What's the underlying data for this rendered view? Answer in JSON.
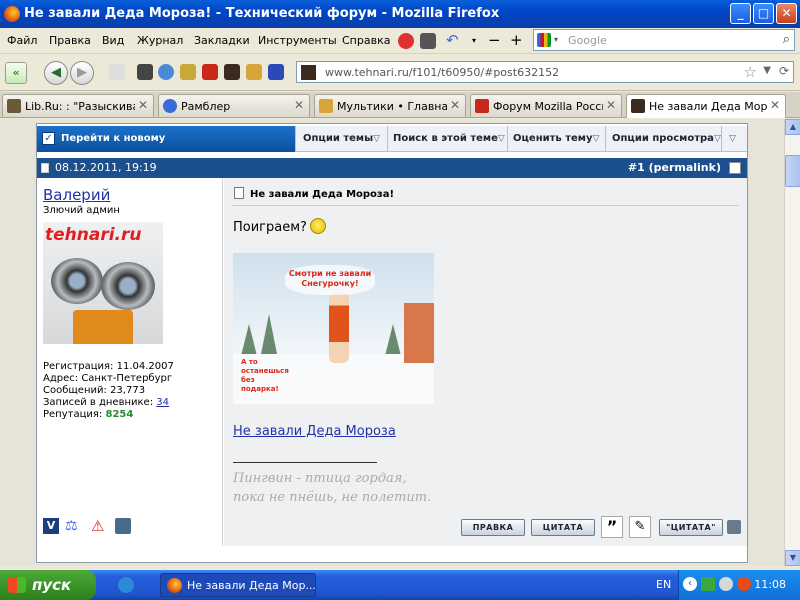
{
  "window": {
    "title": "Не завали Деда Мороза! - Технический форум - Mozilla Firefox",
    "min": "_",
    "max": "□",
    "close": "✕"
  },
  "menu": {
    "items": [
      "Файл",
      "Правка",
      "Вид",
      "Журнал",
      "Закладки",
      "Инструменты",
      "Справка"
    ],
    "search_placeholder": "Google"
  },
  "nav": {
    "back": "◀",
    "forward": "▶",
    "url": "www.tehnari.ru/f101/t60950/#post632152"
  },
  "tabs": [
    {
      "label": "Lib.Ru: : \"Разыскива...",
      "icon_color": "#6a5a3a"
    },
    {
      "label": "Рамблер",
      "icon_color": "#3a6ad8"
    },
    {
      "label": "Мультики • Главная...",
      "icon_color": "#d8a43a"
    },
    {
      "label": "Форум Mozilla Россия",
      "icon_color": "#c8281a"
    },
    {
      "label": "Не завали Деда Мор...",
      "icon_color": "#3a2b1e"
    }
  ],
  "forum": {
    "goto_new": "Перейти к новому",
    "options": [
      {
        "label": "Опции темы"
      },
      {
        "label": "Поиск в этой теме"
      },
      {
        "label": "Оценить тему"
      },
      {
        "label": "Опции просмотра"
      }
    ],
    "post": {
      "date": "08.12.2011, 19:19",
      "number_prefix": "#",
      "number": "1",
      "permalink": "permalink",
      "title": "Не завали Деда Мороза!",
      "text": "Поиграем?",
      "image_caption_top": "Смотри не завали Снегурочку!",
      "image_caption_bottom": "А то останешься без подарка!",
      "image_watermark": "tehnari.ru",
      "link_text": "Не завали Деда Мороза",
      "signature_line1": "Пингвин - птица гордая,",
      "signature_line2": "пока не пнёшь, не полетит."
    },
    "user": {
      "name": "Валерий",
      "title": "Злючий админ",
      "avatar_logo": "tehnari.ru",
      "reg_label": "Регистрация:",
      "reg_value": "11.04.2007",
      "addr_label": "Адрес:",
      "addr_value": "Санкт-Петербург",
      "posts_label": "Сообщений:",
      "posts_value": "23,773",
      "diary_label": "Записей в дневнике:",
      "diary_value": "34",
      "rep_label": "Репутация:",
      "rep_value": "8254"
    },
    "buttons": {
      "edit": "ПРАВКА",
      "quote": "ЦИТАТА",
      "quick_quote": "\"ЦИТАТА\""
    }
  },
  "taskbar": {
    "start": "пуск",
    "task_label": "Не завали Деда Мор...",
    "lang": "EN",
    "time": "11:08"
  }
}
